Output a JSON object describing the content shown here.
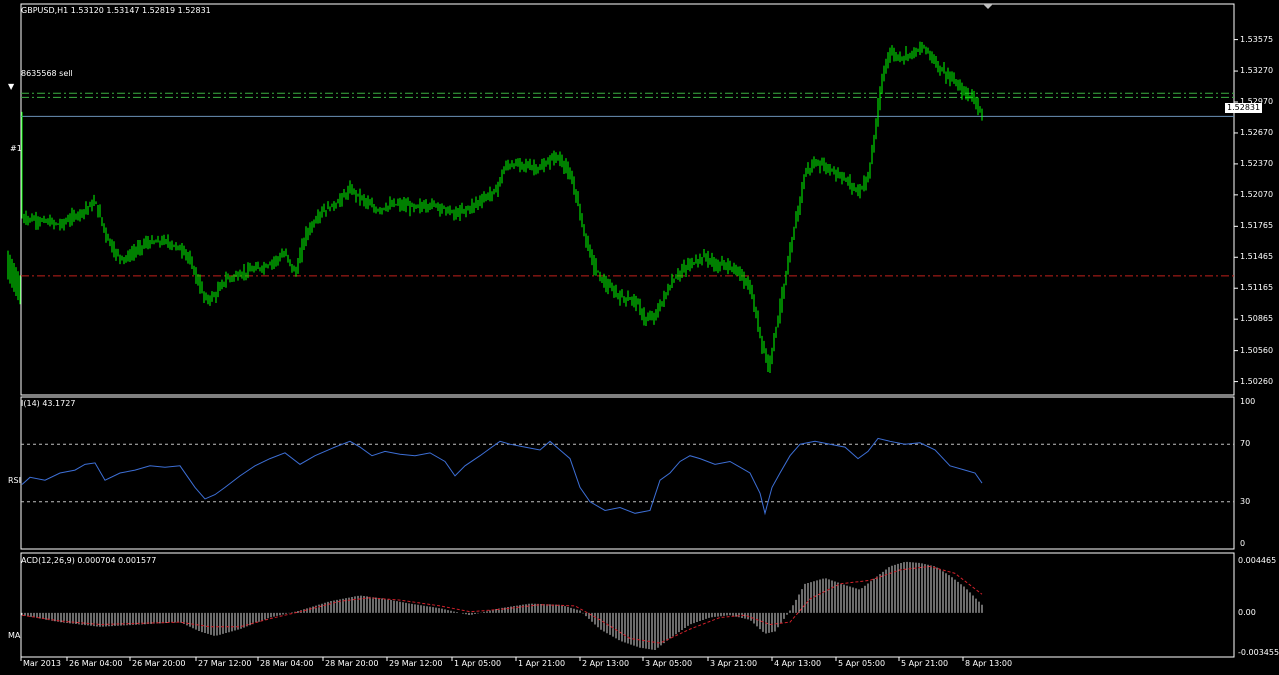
{
  "symbol_info": "GBPUSD,H1  1.53120 1.53147 1.52819 1.52831",
  "order_label": "8635568 sell",
  "order_id_short": "#1",
  "current_price": "1.52831",
  "left_labels": {
    "rsi_cut": "RSI",
    "ma_cut": "MA"
  },
  "price_axis": {
    "ticks": [
      "1.53575",
      "1.53270",
      "1.52970",
      "1.52670",
      "1.52370",
      "1.52070",
      "1.51765",
      "1.51465",
      "1.51165",
      "1.50865",
      "1.50560",
      "1.50260"
    ],
    "tick_values": [
      1.53575,
      1.5327,
      1.5297,
      1.5267,
      1.5237,
      1.5207,
      1.51765,
      1.51465,
      1.51165,
      1.50865,
      1.5056,
      1.5026
    ],
    "ylim": [
      1.5013,
      1.5392
    ]
  },
  "horizontal_lines": [
    {
      "kind": "dash-dot",
      "color": "#3cb043",
      "value": 1.53055
    },
    {
      "kind": "dash-dot",
      "color": "#3cb043",
      "value": 1.53015
    },
    {
      "kind": "solid",
      "color": "#6b93b8",
      "value": 1.52831
    },
    {
      "kind": "dash-dot",
      "color": "#c0201a",
      "value": 1.51285
    }
  ],
  "rsi": {
    "title": "I(14) 43.1727",
    "ticks": [
      "100",
      "70",
      "30",
      "0"
    ],
    "levels": [
      70,
      30
    ],
    "color": "#3d6fd6"
  },
  "macd": {
    "title": "ACD(12,26,9) 0.000704 0.001577",
    "ticks": [
      "0.004465",
      "0.00",
      "-0.003455"
    ],
    "ylim": [
      -0.003455,
      0.004465
    ],
    "signal_color": "#d0202a"
  },
  "time_axis": [
    "Mar 2013",
    "26 Mar 04:00",
    "26 Mar 20:00",
    "27 Mar 12:00",
    "28 Mar 04:00",
    "28 Mar 20:00",
    "29 Mar 12:00",
    "1 Apr 05:00",
    "1 Apr 21:00",
    "2 Apr 13:00",
    "3 Apr 05:00",
    "3 Apr 21:00",
    "4 Apr 13:00",
    "5 Apr 05:00",
    "5 Apr 21:00",
    "8 Apr 13:00"
  ],
  "colors": {
    "candle": "#00ff00",
    "background": "#000000",
    "frame": "#ffffff",
    "grid": "#c0c0c0"
  },
  "price_path": [
    [
      22,
      1.5185
    ],
    [
      40,
      1.5182
    ],
    [
      60,
      1.5178
    ],
    [
      80,
      1.519
    ],
    [
      95,
      1.52
    ],
    [
      105,
      1.517
    ],
    [
      115,
      1.515
    ],
    [
      125,
      1.5145
    ],
    [
      145,
      1.516
    ],
    [
      165,
      1.5162
    ],
    [
      185,
      1.5152
    ],
    [
      195,
      1.513
    ],
    [
      205,
      1.5105
    ],
    [
      215,
      1.511
    ],
    [
      225,
      1.5125
    ],
    [
      245,
      1.5132
    ],
    [
      265,
      1.5138
    ],
    [
      285,
      1.515
    ],
    [
      295,
      1.513
    ],
    [
      305,
      1.5168
    ],
    [
      320,
      1.519
    ],
    [
      335,
      1.5198
    ],
    [
      350,
      1.5212
    ],
    [
      360,
      1.5205
    ],
    [
      375,
      1.5192
    ],
    [
      395,
      1.5198
    ],
    [
      415,
      1.5195
    ],
    [
      435,
      1.5198
    ],
    [
      455,
      1.5188
    ],
    [
      470,
      1.5195
    ],
    [
      485,
      1.5205
    ],
    [
      495,
      1.521
    ],
    [
      505,
      1.5235
    ],
    [
      520,
      1.5237
    ],
    [
      540,
      1.5232
    ],
    [
      555,
      1.5245
    ],
    [
      565,
      1.5235
    ],
    [
      575,
      1.521
    ],
    [
      585,
      1.5165
    ],
    [
      595,
      1.5135
    ],
    [
      605,
      1.512
    ],
    [
      620,
      1.5108
    ],
    [
      635,
      1.5105
    ],
    [
      645,
      1.5085
    ],
    [
      655,
      1.509
    ],
    [
      665,
      1.511
    ],
    [
      675,
      1.5128
    ],
    [
      690,
      1.514
    ],
    [
      705,
      1.5148
    ],
    [
      715,
      1.5138
    ],
    [
      725,
      1.514
    ],
    [
      740,
      1.513
    ],
    [
      750,
      1.5115
    ],
    [
      760,
      1.507
    ],
    [
      768,
      1.504
    ],
    [
      775,
      1.5075
    ],
    [
      785,
      1.5125
    ],
    [
      795,
      1.518
    ],
    [
      805,
      1.523
    ],
    [
      815,
      1.5238
    ],
    [
      830,
      1.5232
    ],
    [
      845,
      1.5222
    ],
    [
      858,
      1.521
    ],
    [
      868,
      1.5225
    ],
    [
      875,
      1.527
    ],
    [
      882,
      1.532
    ],
    [
      888,
      1.5345
    ],
    [
      900,
      1.534
    ],
    [
      912,
      1.5345
    ],
    [
      925,
      1.535
    ],
    [
      935,
      1.5335
    ],
    [
      945,
      1.5325
    ],
    [
      955,
      1.5315
    ],
    [
      965,
      1.5305
    ],
    [
      975,
      1.53
    ],
    [
      982,
      1.5283
    ]
  ],
  "rsi_path": [
    [
      22,
      42
    ],
    [
      30,
      47
    ],
    [
      45,
      45
    ],
    [
      60,
      50
    ],
    [
      75,
      52
    ],
    [
      85,
      56
    ],
    [
      95,
      57
    ],
    [
      105,
      45
    ],
    [
      120,
      50
    ],
    [
      135,
      52
    ],
    [
      150,
      55
    ],
    [
      165,
      54
    ],
    [
      180,
      55
    ],
    [
      195,
      40
    ],
    [
      205,
      32
    ],
    [
      215,
      35
    ],
    [
      225,
      40
    ],
    [
      240,
      48
    ],
    [
      255,
      55
    ],
    [
      270,
      60
    ],
    [
      285,
      64
    ],
    [
      300,
      56
    ],
    [
      315,
      62
    ],
    [
      335,
      68
    ],
    [
      350,
      72
    ],
    [
      360,
      68
    ],
    [
      372,
      62
    ],
    [
      385,
      65
    ],
    [
      400,
      63
    ],
    [
      415,
      62
    ],
    [
      430,
      64
    ],
    [
      445,
      58
    ],
    [
      455,
      48
    ],
    [
      465,
      55
    ],
    [
      480,
      62
    ],
    [
      490,
      67
    ],
    [
      500,
      72
    ],
    [
      510,
      70
    ],
    [
      525,
      68
    ],
    [
      540,
      66
    ],
    [
      550,
      72
    ],
    [
      560,
      66
    ],
    [
      570,
      60
    ],
    [
      580,
      40
    ],
    [
      590,
      30
    ],
    [
      605,
      24
    ],
    [
      620,
      26
    ],
    [
      635,
      22
    ],
    [
      650,
      24
    ],
    [
      660,
      45
    ],
    [
      670,
      50
    ],
    [
      680,
      58
    ],
    [
      690,
      62
    ],
    [
      700,
      60
    ],
    [
      715,
      56
    ],
    [
      730,
      58
    ],
    [
      740,
      54
    ],
    [
      750,
      50
    ],
    [
      760,
      36
    ],
    [
      765,
      22
    ],
    [
      772,
      40
    ],
    [
      780,
      50
    ],
    [
      790,
      62
    ],
    [
      800,
      70
    ],
    [
      815,
      72
    ],
    [
      830,
      70
    ],
    [
      845,
      68
    ],
    [
      858,
      60
    ],
    [
      868,
      65
    ],
    [
      878,
      74
    ],
    [
      890,
      72
    ],
    [
      905,
      70
    ],
    [
      920,
      71
    ],
    [
      935,
      66
    ],
    [
      950,
      55
    ],
    [
      965,
      52
    ],
    [
      975,
      50
    ],
    [
      982,
      43
    ]
  ],
  "macd_path": [
    [
      22,
      -0.0002
    ],
    [
      60,
      -0.0008
    ],
    [
      100,
      -0.0012
    ],
    [
      140,
      -0.001
    ],
    [
      180,
      -0.0008
    ],
    [
      200,
      -0.0016
    ],
    [
      215,
      -0.002
    ],
    [
      240,
      -0.0014
    ],
    [
      270,
      -0.0004
    ],
    [
      300,
      0.0002
    ],
    [
      330,
      0.001
    ],
    [
      360,
      0.0015
    ],
    [
      385,
      0.0012
    ],
    [
      410,
      0.0008
    ],
    [
      440,
      0.0004
    ],
    [
      470,
      -0.0002
    ],
    [
      500,
      0.0004
    ],
    [
      530,
      0.0008
    ],
    [
      560,
      0.0007
    ],
    [
      580,
      0.0002
    ],
    [
      600,
      -0.0014
    ],
    [
      620,
      -0.0024
    ],
    [
      640,
      -0.003
    ],
    [
      655,
      -0.0032
    ],
    [
      670,
      -0.0022
    ],
    [
      690,
      -0.001
    ],
    [
      710,
      -0.0004
    ],
    [
      730,
      -0.0002
    ],
    [
      750,
      -0.0006
    ],
    [
      765,
      -0.0018
    ],
    [
      775,
      -0.0016
    ],
    [
      790,
      0.0002
    ],
    [
      805,
      0.0025
    ],
    [
      825,
      0.003
    ],
    [
      845,
      0.0024
    ],
    [
      860,
      0.002
    ],
    [
      875,
      0.003
    ],
    [
      890,
      0.004
    ],
    [
      905,
      0.0044
    ],
    [
      920,
      0.0043
    ],
    [
      935,
      0.004
    ],
    [
      950,
      0.0032
    ],
    [
      965,
      0.0022
    ],
    [
      982,
      0.0007
    ]
  ],
  "signal_path": [
    [
      22,
      -0.0002
    ],
    [
      60,
      -0.0007
    ],
    [
      100,
      -0.001
    ],
    [
      140,
      -0.0009
    ],
    [
      180,
      -0.0008
    ],
    [
      210,
      -0.0012
    ],
    [
      240,
      -0.0012
    ],
    [
      270,
      -0.0005
    ],
    [
      300,
      0.0001
    ],
    [
      340,
      0.001
    ],
    [
      370,
      0.0013
    ],
    [
      400,
      0.0011
    ],
    [
      440,
      0.0006
    ],
    [
      470,
      0.0001
    ],
    [
      500,
      0.0003
    ],
    [
      540,
      0.0007
    ],
    [
      575,
      0.0006
    ],
    [
      600,
      -0.0006
    ],
    [
      630,
      -0.0022
    ],
    [
      660,
      -0.0026
    ],
    [
      690,
      -0.0014
    ],
    [
      720,
      -0.0004
    ],
    [
      745,
      -0.0002
    ],
    [
      770,
      -0.001
    ],
    [
      790,
      -0.0008
    ],
    [
      810,
      0.0012
    ],
    [
      840,
      0.0025
    ],
    [
      870,
      0.0028
    ],
    [
      900,
      0.0037
    ],
    [
      930,
      0.004
    ],
    [
      955,
      0.0034
    ],
    [
      982,
      0.0016
    ]
  ]
}
